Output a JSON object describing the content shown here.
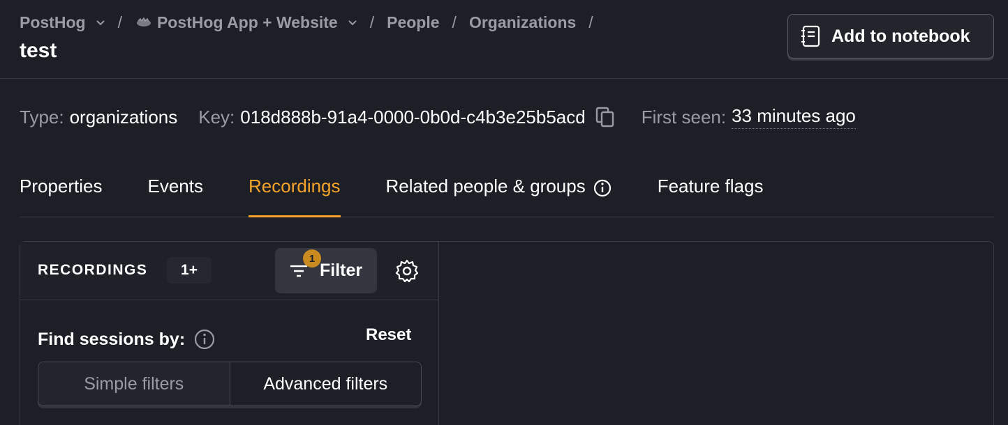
{
  "breadcrumb": {
    "org": "PostHog",
    "project": "PostHog App + Website",
    "people": "People",
    "organizations": "Organizations",
    "separator": "/"
  },
  "page": {
    "title": "test"
  },
  "toolbar": {
    "add_to_notebook": "Add to notebook"
  },
  "meta": {
    "type_label": "Type:",
    "type_value": "organizations",
    "key_label": "Key:",
    "key_value": "018d888b-91a4-0000-0b0d-c4b3e25b5acd",
    "first_seen_label": "First seen:",
    "first_seen_value": "33 minutes ago"
  },
  "tabs": [
    {
      "label": "Properties",
      "active": false
    },
    {
      "label": "Events",
      "active": false
    },
    {
      "label": "Recordings",
      "active": true
    },
    {
      "label": "Related people & groups",
      "active": false
    },
    {
      "label": "Feature flags",
      "active": false
    }
  ],
  "recordings": {
    "title": "RECORDINGS",
    "count": "1+",
    "filter_label": "Filter",
    "filter_badge": "1",
    "find_label": "Find sessions by:",
    "reset_label": "Reset",
    "modes": [
      {
        "label": "Simple filters",
        "active": false
      },
      {
        "label": "Advanced filters",
        "active": true
      }
    ]
  },
  "colors": {
    "background": "#1d1f27",
    "accent": "#f5a32a",
    "badge": "#c98a1f"
  }
}
